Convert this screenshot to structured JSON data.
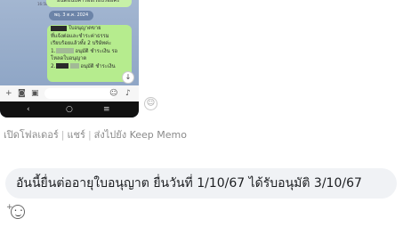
{
  "phone": {
    "time_top": "16:58 น.",
    "top_bubble_text": "ยินดีแนบคำร้องเรียบร้อยค่ะ",
    "date_pill": "พฤ. 3 ต.ค. 2024",
    "message_lines": [
      "ใบอนุญาตขาย",
      "ที่แจ้งต่อและชำระค่าธรรม",
      "เรียบร้อยแล้วทั้ง 2 บริษัทค่ะ",
      "อนุมัติ ชำระเงิน รอ",
      "โหลดใบอนุญาต",
      "อนุมัติ ชำระเงิน"
    ],
    "scroll_down_icon": "arrow-down",
    "input_icons": [
      "plus-icon",
      "camera-icon",
      "image-icon",
      "emoji-icon",
      "microphone-icon"
    ],
    "nav_icons": [
      "back-icon",
      "home-icon",
      "recent-apps-icon"
    ]
  },
  "react_icon": "smiley-icon",
  "file_actions": {
    "open_folder": "เปิดโฟลเดอร์",
    "share": "แชร์",
    "send_to_keep": "ส่งไปยัง Keep Memo"
  },
  "comment": {
    "text": "อันนี้ยื่นต่ออายุใบอนุญาต ยื่นวันที่ 1/10/67 ได้รับอนุมัติ 3/10/67"
  },
  "add_reaction_icon": "add-reaction-icon"
}
